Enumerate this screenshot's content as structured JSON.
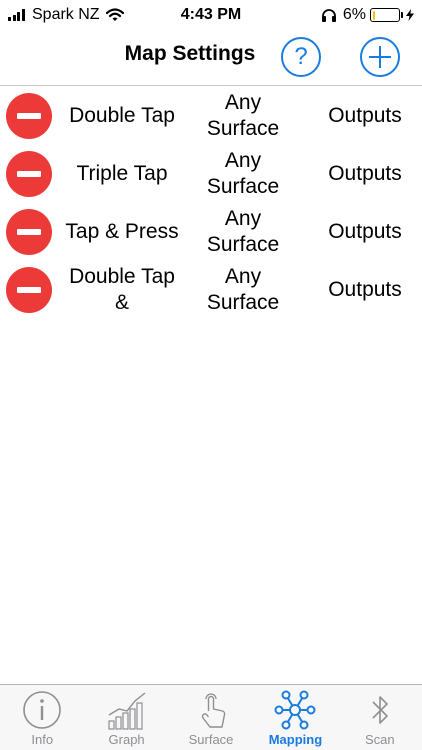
{
  "status_bar": {
    "carrier": "Spark NZ",
    "time": "4:43 PM",
    "battery": "6%",
    "battery_level": 0.06
  },
  "nav": {
    "title": "Map Settings",
    "help_label": "?"
  },
  "mappings": [
    {
      "gesture": "Double Tap",
      "surface": "Any Surface",
      "outputs": "Outputs"
    },
    {
      "gesture": "Triple Tap",
      "surface": "Any Surface",
      "outputs": "Outputs"
    },
    {
      "gesture": "Tap & Press",
      "surface": "Any Surface",
      "outputs": "Outputs"
    },
    {
      "gesture": "Double Tap &",
      "surface": "Any Surface",
      "outputs": "Outputs"
    }
  ],
  "tabs": [
    {
      "label": "Info",
      "icon": "info-icon"
    },
    {
      "label": "Graph",
      "icon": "graph-icon"
    },
    {
      "label": "Surface",
      "icon": "touch-icon"
    },
    {
      "label": "Mapping",
      "icon": "network-icon",
      "active": true
    },
    {
      "label": "Scan",
      "icon": "bluetooth-icon"
    }
  ],
  "colors": {
    "accent": "#1a7be0",
    "delete": "#ec3a39",
    "inactive": "#8e8e93",
    "battery_low": "#f4c20d"
  }
}
